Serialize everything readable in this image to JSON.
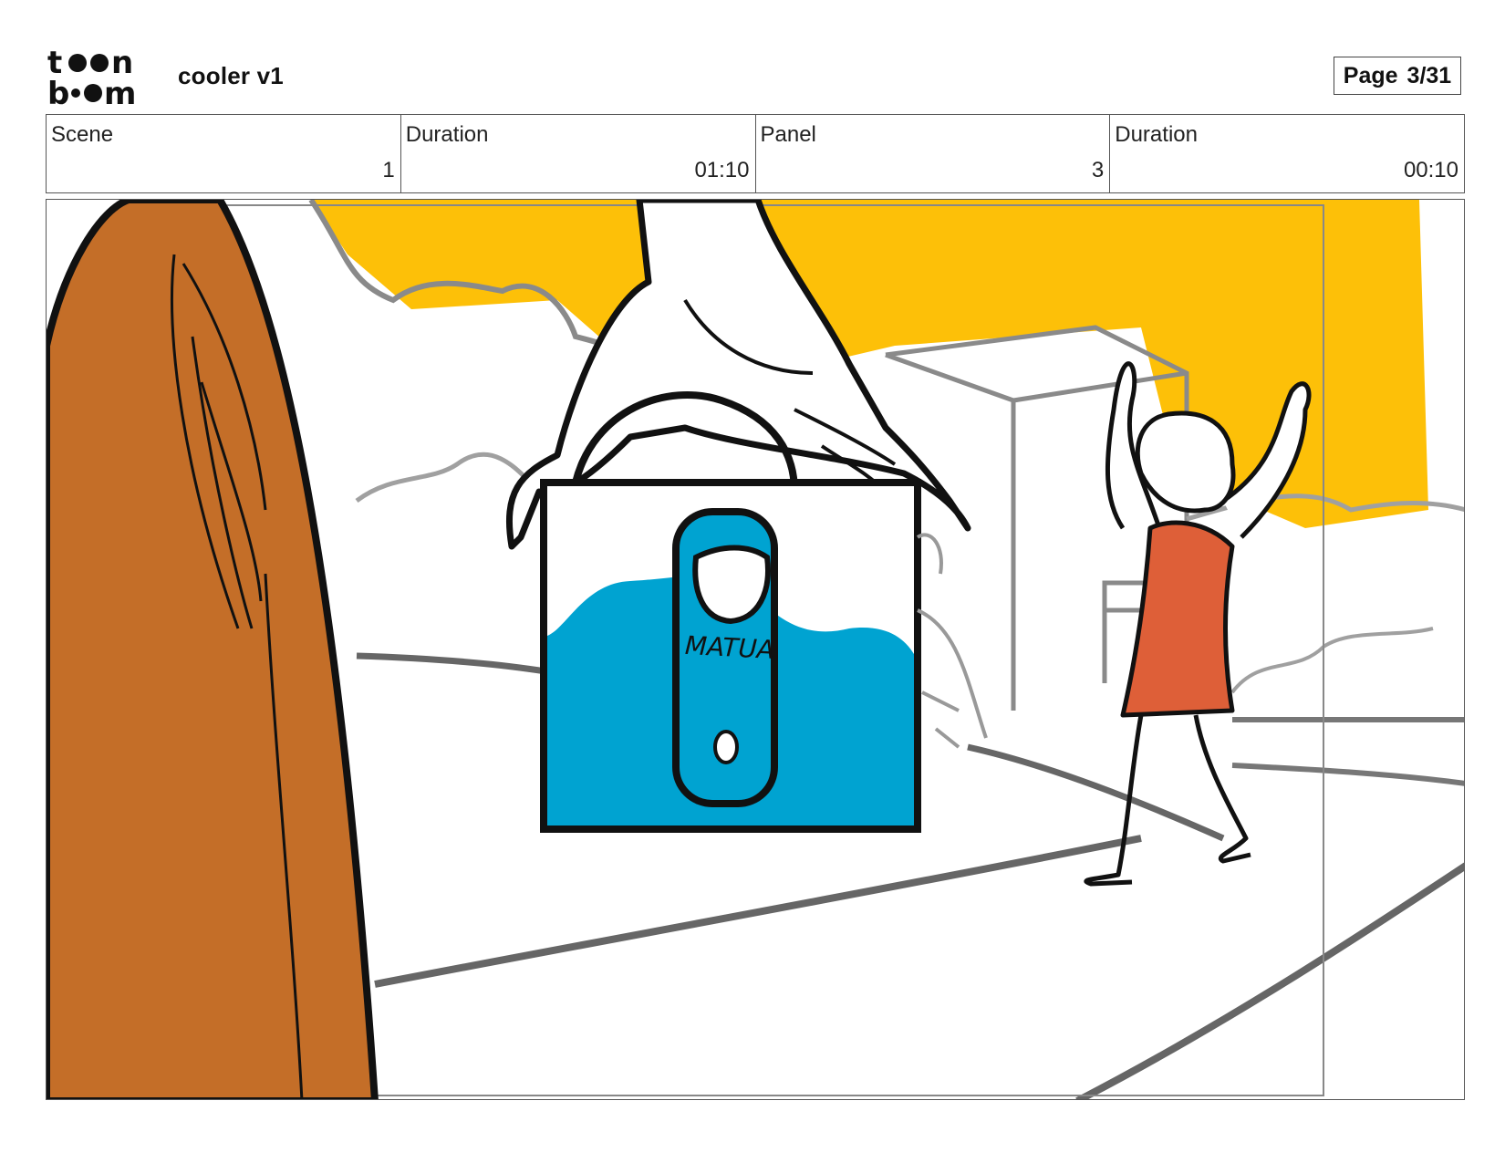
{
  "header": {
    "logo_text_top": "toon",
    "logo_text_bottom": "boom",
    "project_title": "cooler v1",
    "page_label": "Page",
    "page_value": "3/31"
  },
  "info": {
    "scene_label": "Scene",
    "scene_value": "1",
    "scene_duration_label": "Duration",
    "scene_duration_value": "01:10",
    "panel_label": "Panel",
    "panel_value": "3",
    "panel_duration_label": "Duration",
    "panel_duration_value": "00:10"
  },
  "panel_art": {
    "cooler_text": "MATUA",
    "colors": {
      "sky": "#FDC008",
      "door": "#C46E28",
      "cooler_water": "#00A3D1",
      "dress": "#DE5F38",
      "ink": "#111111",
      "sketch": "#8a8a8a"
    }
  }
}
